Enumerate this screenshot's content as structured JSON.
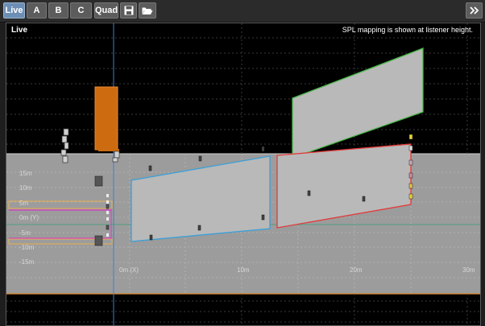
{
  "toolbar": {
    "buttons": [
      {
        "label": "Live",
        "active": true
      },
      {
        "label": "A",
        "active": false
      },
      {
        "label": "B",
        "active": false
      },
      {
        "label": "C",
        "active": false
      },
      {
        "label": "Quad",
        "active": false
      }
    ],
    "save_icon": "save-icon",
    "open_icon": "open-folder-icon",
    "expand_icon": "double-chevron-right-icon"
  },
  "view": {
    "title": "Live",
    "note": "SPL mapping is shown at listener height."
  },
  "grid": {
    "y_labels": [
      "15m",
      "10m",
      "5m",
      "0m (Y)",
      "-5m",
      "-10m",
      "-15m"
    ],
    "x_labels": [
      "0m (X)",
      "10m",
      "20m",
      "30m"
    ]
  },
  "colors": {
    "floor": "#9c9c9c",
    "surface": "#b9b9b9",
    "blue_outline": "#3aa0d8",
    "red_outline": "#e23b3b",
    "green_outline": "#4bb84b",
    "speaker_stack": "#cc6b10",
    "active_tab": "#6d8fb5"
  }
}
